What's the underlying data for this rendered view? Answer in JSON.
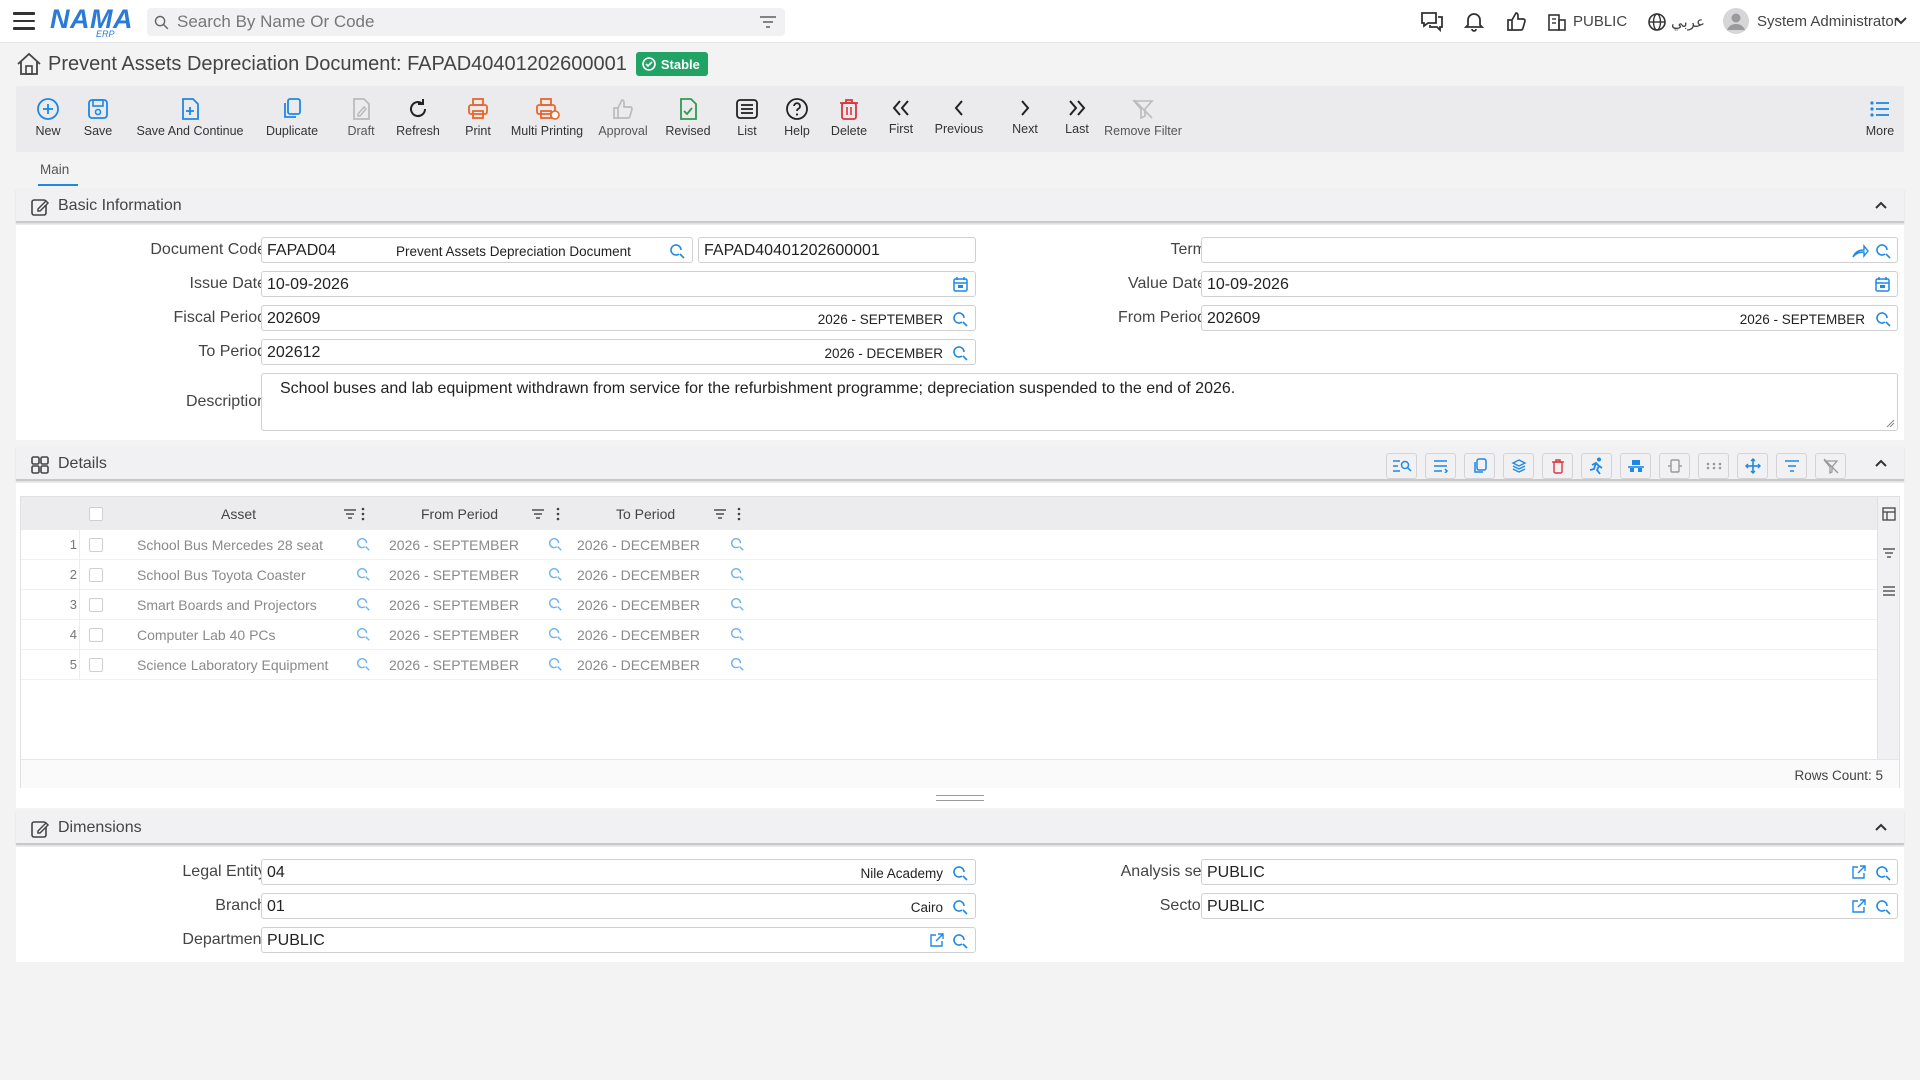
{
  "header": {
    "logo_text": "NAMA",
    "logo_sub": "ERP",
    "search_placeholder": "Search By Name Or Code",
    "company": "PUBLIC",
    "language": "عربي",
    "user": "System Administrator"
  },
  "page": {
    "title": "Prevent Assets Depreciation Document: FAPAD40401202600001",
    "status": "Stable"
  },
  "toolbar": {
    "new": "New",
    "save": "Save",
    "save_continue": "Save And Continue",
    "duplicate": "Duplicate",
    "draft": "Draft",
    "refresh": "Refresh",
    "print": "Print",
    "multi_printing": "Multi Printing",
    "approval": "Approval",
    "revised": "Revised",
    "list": "List",
    "help": "Help",
    "delete": "Delete",
    "first": "First",
    "previous": "Previous",
    "next": "Next",
    "last": "Last",
    "remove_filter": "Remove Filter",
    "more": "More"
  },
  "tabs": {
    "main": "Main"
  },
  "basic": {
    "section_title": "Basic Information",
    "document_code_label": "Document Code",
    "document_code": "FAPAD04",
    "document_code_desc": "Prevent Assets Depreciation Document",
    "document_number": "FAPAD40401202600001",
    "term_label": "Term",
    "term": "",
    "issue_date_label": "Issue Date",
    "issue_date": "10-09-2026",
    "value_date_label": "Value Date",
    "value_date": "10-09-2026",
    "fiscal_period_label": "Fiscal Period",
    "fiscal_period": "202609",
    "fiscal_period_desc": "2026 - SEPTEMBER",
    "from_period_label": "From Period",
    "from_period": "202609",
    "from_period_desc": "2026 - SEPTEMBER",
    "to_period_label": "To Period",
    "to_period": "202612",
    "to_period_desc": "2026 - DECEMBER",
    "description_label": "Description",
    "description": "School buses and lab equipment withdrawn from service for the refurbishment programme; depreciation suspended to the end of 2026."
  },
  "details": {
    "section_title": "Details",
    "columns": {
      "asset": "Asset",
      "from_period": "From Period",
      "to_period": "To Period"
    },
    "rows": [
      {
        "n": "1",
        "asset": "School Bus Mercedes 28 seat",
        "from": "2026 - SEPTEMBER",
        "to": "2026 - DECEMBER"
      },
      {
        "n": "2",
        "asset": "School Bus Toyota Coaster",
        "from": "2026 - SEPTEMBER",
        "to": "2026 - DECEMBER"
      },
      {
        "n": "3",
        "asset": "Smart Boards and Projectors",
        "from": "2026 - SEPTEMBER",
        "to": "2026 - DECEMBER"
      },
      {
        "n": "4",
        "asset": "Computer Lab 40 PCs",
        "from": "2026 - SEPTEMBER",
        "to": "2026 - DECEMBER"
      },
      {
        "n": "5",
        "asset": "Science Laboratory Equipment",
        "from": "2026 - SEPTEMBER",
        "to": "2026 - DECEMBER"
      }
    ],
    "rows_count": "Rows Count: 5"
  },
  "dimensions": {
    "section_title": "Dimensions",
    "legal_entity_label": "Legal Entity",
    "legal_entity": "04",
    "legal_entity_desc": "Nile Academy",
    "analysis_set_label": "Analysis set",
    "analysis_set": "PUBLIC",
    "branch_label": "Branch",
    "branch": "01",
    "branch_desc": "Cairo",
    "sector_label": "Sector",
    "sector": "PUBLIC",
    "department_label": "Department",
    "department": "PUBLIC"
  },
  "colors": {
    "accent": "#1e88e5",
    "stable": "#21a366",
    "print": "#e8662a",
    "delete": "#d9363e",
    "revised": "#2e9d4f"
  }
}
